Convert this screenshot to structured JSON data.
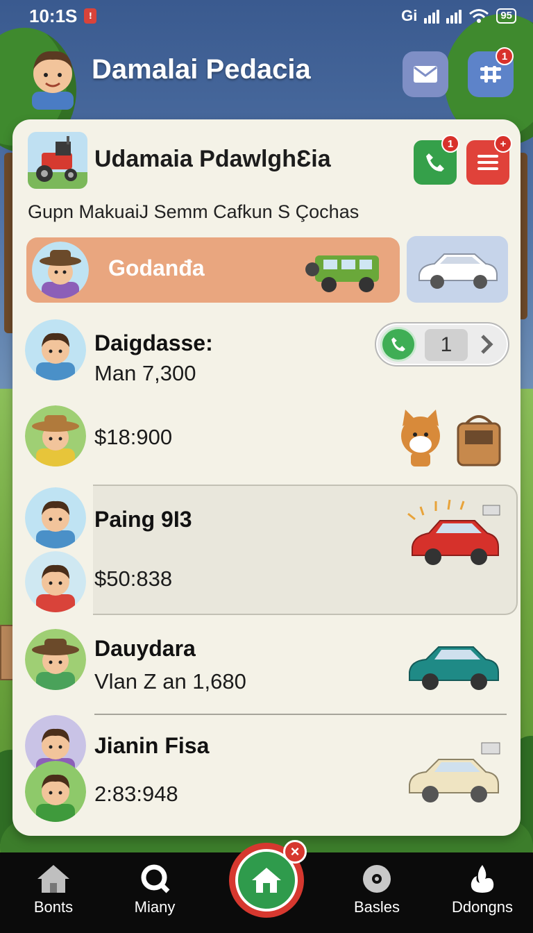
{
  "status_bar": {
    "time": "10:1S",
    "network": "Gi",
    "battery": "95",
    "notification_icon": "alert-icon"
  },
  "header": {
    "title": "Damalai Pedacia",
    "mail_badge": "",
    "menu_badge": "1",
    "icons": [
      "mail-icon",
      "menu-icon"
    ]
  },
  "card": {
    "title": "Udamaia PdawlghƐia",
    "call_badge": "1",
    "note_badge": "+",
    "subtitle": "Gupn MakuaiJ Semm Cafkun S Çochas",
    "featured": {
      "label": "Godanđa"
    },
    "rows": [
      {
        "name": "Daigdasse:",
        "value": "Man 7,300",
        "counter": "1"
      },
      {
        "name": "",
        "value": "$18:900"
      },
      {
        "name": "Paing 9I3",
        "value": "$50:838"
      },
      {
        "name": "Dauydara",
        "value": "Vlan Z an 1,680"
      },
      {
        "name": "Jianin Fisa",
        "value": "2:83:948"
      }
    ]
  },
  "bottom_nav": {
    "items": [
      {
        "label": "Bonts",
        "icon": "house-icon"
      },
      {
        "label": "Miany",
        "icon": "search-icon"
      },
      {
        "label": "",
        "icon": "home-icon"
      },
      {
        "label": "Basles",
        "icon": "disc-icon"
      },
      {
        "label": "Ddongns",
        "icon": "flame-icon"
      }
    ],
    "home_close": "×"
  },
  "colors": {
    "accent_green": "#35a04a",
    "accent_red": "#e0423a",
    "featured_bg": "#e9a67f",
    "card_bg": "#f4f2e7"
  }
}
